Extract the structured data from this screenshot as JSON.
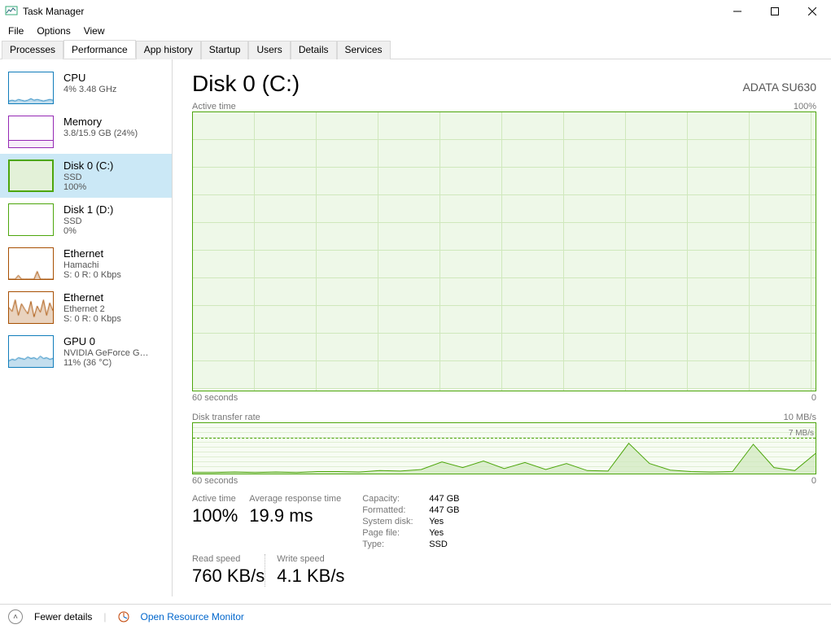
{
  "window": {
    "title": "Task Manager"
  },
  "menu": {
    "file": "File",
    "options": "Options",
    "view": "View"
  },
  "tabs": [
    "Processes",
    "Performance",
    "App history",
    "Startup",
    "Users",
    "Details",
    "Services"
  ],
  "active_tab_index": 1,
  "sidebar": [
    {
      "kind": "cpu",
      "title": "CPU",
      "line2": "4% 3.48 GHz",
      "line3": ""
    },
    {
      "kind": "mem",
      "title": "Memory",
      "line2": "3.8/15.9 GB (24%)",
      "line3": ""
    },
    {
      "kind": "disk",
      "title": "Disk 0 (C:)",
      "line2": "SSD",
      "line3": "100%",
      "selected": true
    },
    {
      "kind": "disk-idle",
      "title": "Disk 1 (D:)",
      "line2": "SSD",
      "line3": "0%"
    },
    {
      "kind": "eth",
      "title": "Ethernet",
      "line2": "Hamachi",
      "line3": "S: 0 R: 0 Kbps"
    },
    {
      "kind": "eth",
      "title": "Ethernet",
      "line2": "Ethernet 2",
      "line3": "S: 0 R: 0 Kbps"
    },
    {
      "kind": "gpu",
      "title": "GPU 0",
      "line2": "NVIDIA GeForce G…",
      "line3": "11%  (36 °C)"
    }
  ],
  "detail": {
    "title": "Disk 0 (C:)",
    "model": "ADATA SU630",
    "top_chart": {
      "label": "Active time",
      "right": "100%",
      "xleft": "60 seconds",
      "xright": "0"
    },
    "bottom_chart": {
      "label": "Disk transfer rate",
      "right": "10 MB/s",
      "dashed": "7 MB/s",
      "xleft": "60 seconds",
      "xright": "0"
    },
    "active_time": {
      "label": "Active time",
      "value": "100%"
    },
    "avg_resp": {
      "label": "Average response time",
      "value": "19.9 ms"
    },
    "read": {
      "label": "Read speed",
      "value": "760 KB/s"
    },
    "write": {
      "label": "Write speed",
      "value": "4.1 KB/s"
    },
    "info": [
      {
        "k": "Capacity:",
        "v": "447 GB"
      },
      {
        "k": "Formatted:",
        "v": "447 GB"
      },
      {
        "k": "System disk:",
        "v": "Yes"
      },
      {
        "k": "Page file:",
        "v": "Yes"
      },
      {
        "k": "Type:",
        "v": "SSD"
      }
    ]
  },
  "footer": {
    "fewer": "Fewer details",
    "monitor": "Open Resource Monitor"
  },
  "chart_data": {
    "type": "line",
    "title": "Disk transfer rate",
    "xlabel": "seconds ago",
    "ylabel": "MB/s",
    "ylim": [
      0,
      10
    ],
    "x": [
      60,
      58,
      56,
      54,
      52,
      50,
      48,
      46,
      44,
      42,
      40,
      38,
      36,
      34,
      32,
      30,
      28,
      26,
      24,
      22,
      20,
      18,
      16,
      14,
      12,
      10,
      8,
      6,
      4,
      2,
      0
    ],
    "values": [
      0.2,
      0.2,
      0.3,
      0.2,
      0.3,
      0.2,
      0.4,
      0.4,
      0.3,
      0.6,
      0.5,
      0.8,
      2.3,
      1.2,
      2.5,
      1.0,
      2.2,
      0.8,
      2.0,
      0.6,
      0.5,
      6.0,
      2.0,
      0.7,
      0.4,
      0.3,
      0.4,
      5.8,
      1.2,
      0.6,
      4.0
    ]
  }
}
